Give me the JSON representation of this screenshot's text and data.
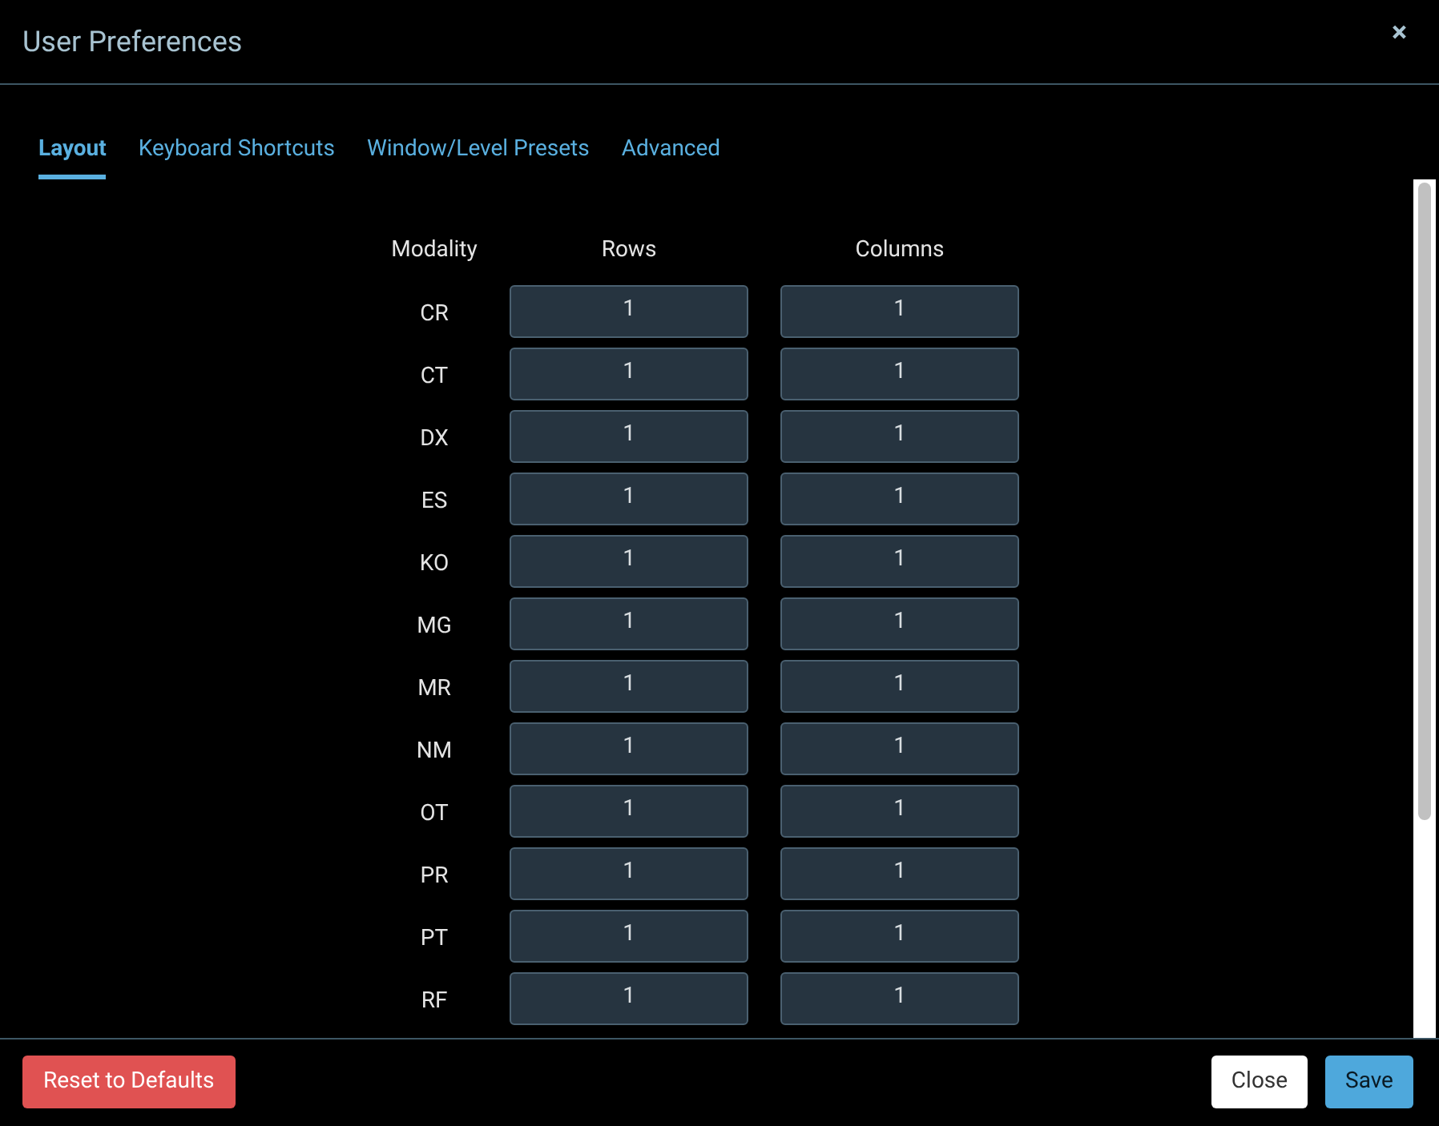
{
  "dialog": {
    "title": "User Preferences",
    "close_icon": "×"
  },
  "tabs": [
    {
      "label": "Layout",
      "selected": true
    },
    {
      "label": "Keyboard Shortcuts",
      "selected": false
    },
    {
      "label": "Window/Level Presets",
      "selected": false
    },
    {
      "label": "Advanced",
      "selected": false
    }
  ],
  "table": {
    "columns": [
      "Modality",
      "Rows",
      "Columns"
    ],
    "rows": [
      {
        "modality": "CR",
        "rows": "1",
        "columns": "1"
      },
      {
        "modality": "CT",
        "rows": "1",
        "columns": "1"
      },
      {
        "modality": "DX",
        "rows": "1",
        "columns": "1"
      },
      {
        "modality": "ES",
        "rows": "1",
        "columns": "1"
      },
      {
        "modality": "KO",
        "rows": "1",
        "columns": "1"
      },
      {
        "modality": "MG",
        "rows": "1",
        "columns": "1"
      },
      {
        "modality": "MR",
        "rows": "1",
        "columns": "1"
      },
      {
        "modality": "NM",
        "rows": "1",
        "columns": "1"
      },
      {
        "modality": "OT",
        "rows": "1",
        "columns": "1"
      },
      {
        "modality": "PR",
        "rows": "1",
        "columns": "1"
      },
      {
        "modality": "PT",
        "rows": "1",
        "columns": "1"
      },
      {
        "modality": "RF",
        "rows": "1",
        "columns": "1"
      }
    ]
  },
  "footer": {
    "reset": "Reset to Defaults",
    "close": "Close",
    "save": "Save"
  }
}
